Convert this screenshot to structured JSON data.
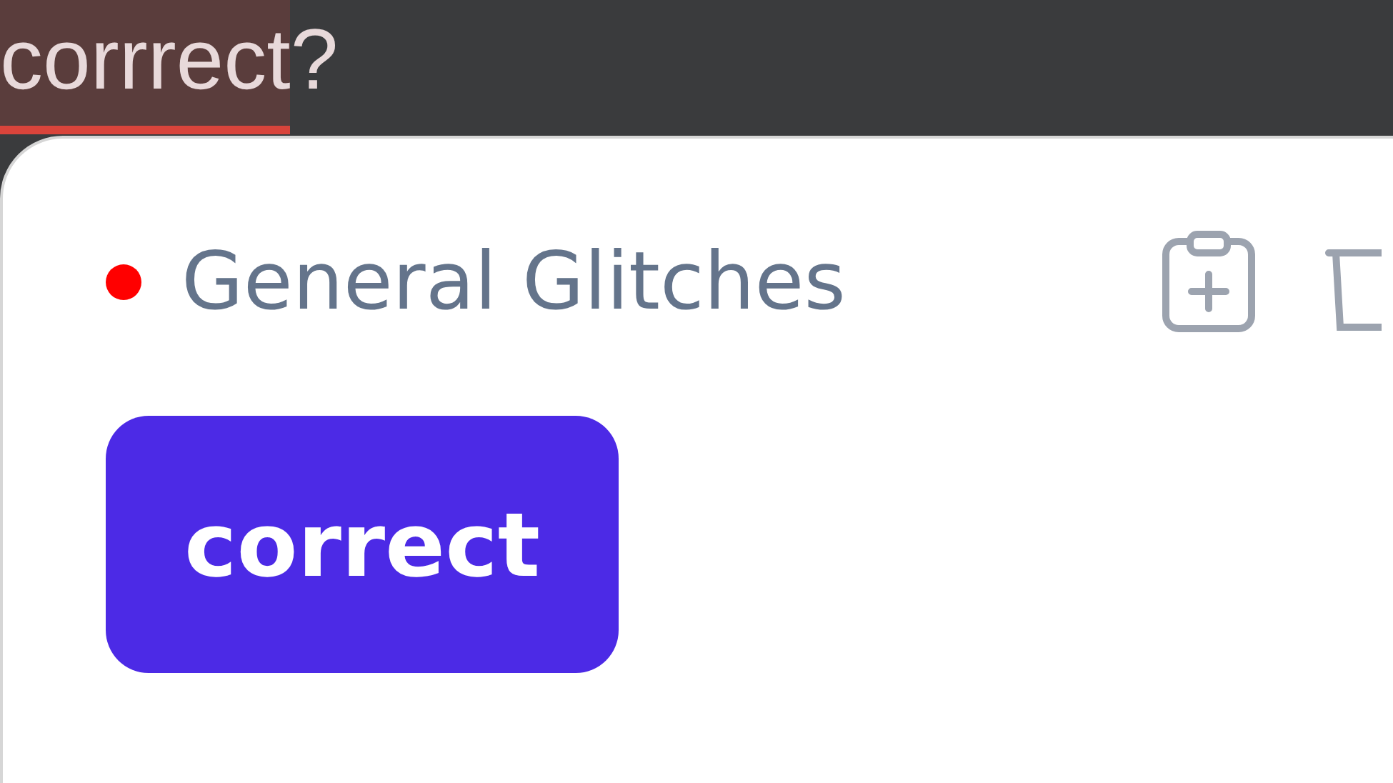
{
  "editor": {
    "misspelled_word": "corrrect",
    "trailing_text": "?"
  },
  "popup": {
    "color": "#ff0000",
    "title": "General Glitches",
    "suggestion": "correct"
  }
}
